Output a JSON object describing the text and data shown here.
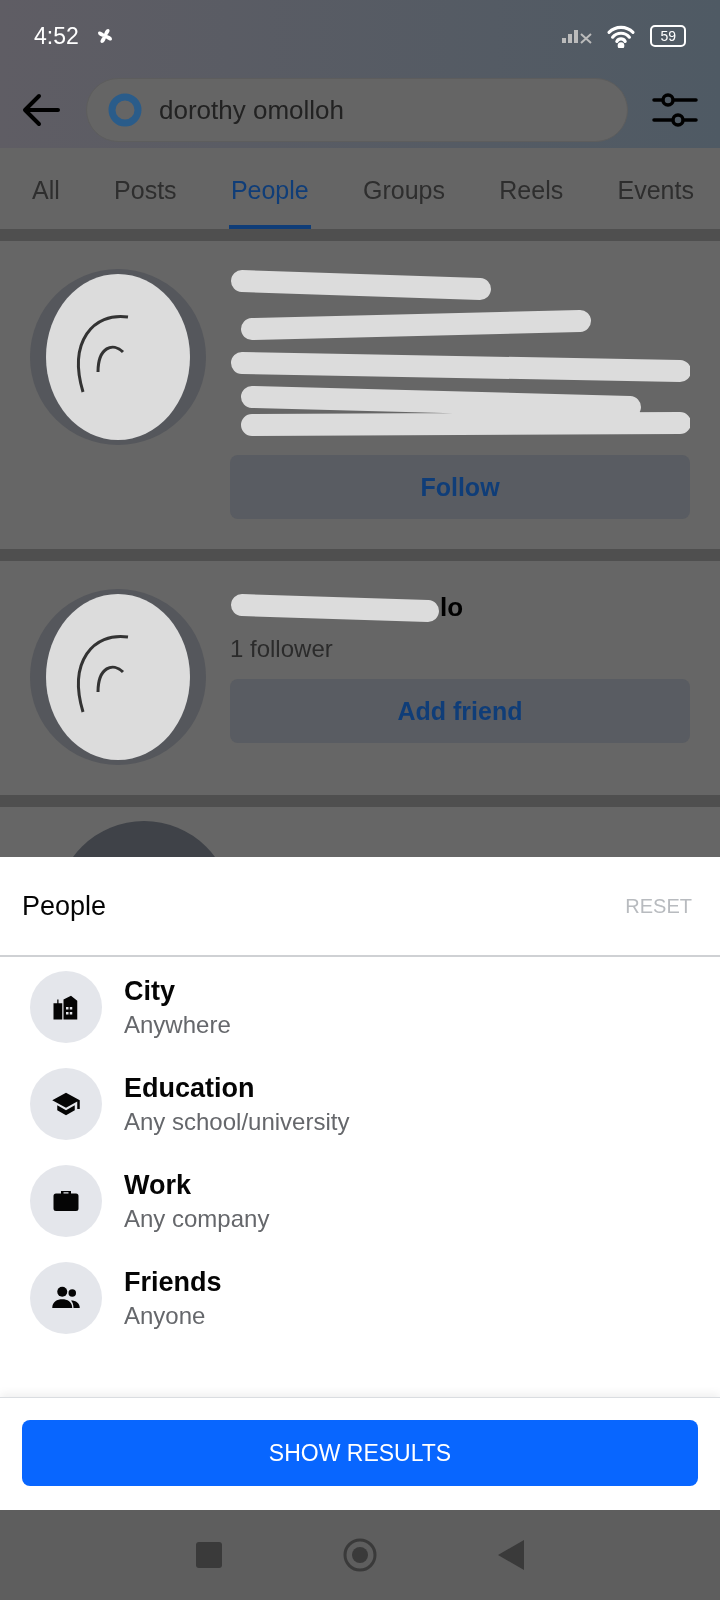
{
  "status_bar": {
    "time": "4:52",
    "battery": "59"
  },
  "search": {
    "value": "dorothy omolloh"
  },
  "tabs": [
    {
      "label": "All",
      "selected": false
    },
    {
      "label": "Posts",
      "selected": false
    },
    {
      "label": "People",
      "selected": true
    },
    {
      "label": "Groups",
      "selected": false
    },
    {
      "label": "Reels",
      "selected": false
    },
    {
      "label": "Events",
      "selected": false
    }
  ],
  "results": [
    {
      "button": "Follow"
    },
    {
      "name_visible": "lo",
      "subtitle": "1 follower",
      "button": "Add friend"
    }
  ],
  "sheet": {
    "title": "People",
    "reset": "RESET",
    "filters": [
      {
        "kind": "city",
        "label": "City",
        "value": "Anywhere"
      },
      {
        "kind": "education",
        "label": "Education",
        "value": "Any school/university"
      },
      {
        "kind": "work",
        "label": "Work",
        "value": "Any company"
      },
      {
        "kind": "friends",
        "label": "Friends",
        "value": "Anyone"
      }
    ],
    "action": "SHOW RESULTS"
  }
}
